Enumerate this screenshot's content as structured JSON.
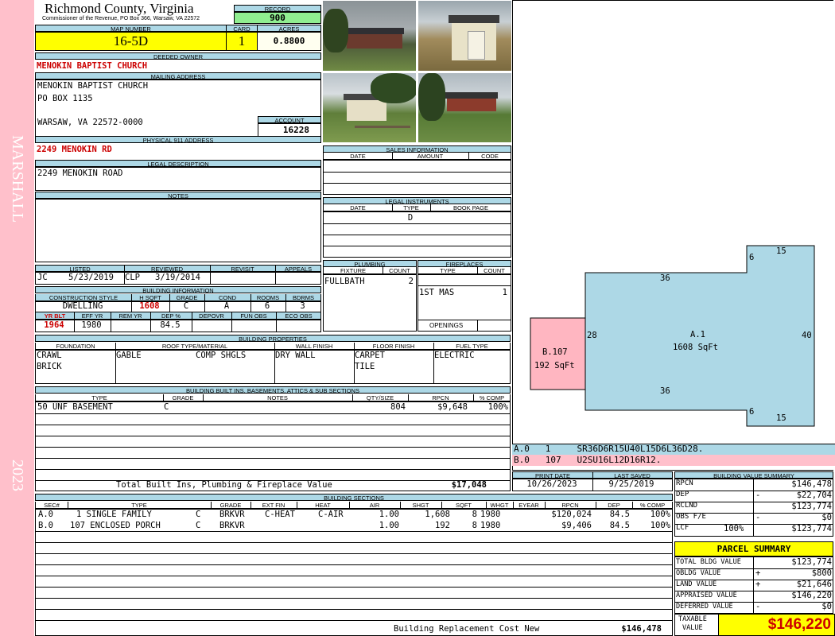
{
  "side": {
    "district": "MARSHALL",
    "year": "2023"
  },
  "header": {
    "county": "Richmond County, Virginia",
    "commissioner": "Commissioner of the Revenue, PO Box 366, Warsaw, VA 22572",
    "record_label": "RECORD",
    "record": "900",
    "map_label": "MAP NUMBER",
    "map_number": "16-5D",
    "card_label": "CARD",
    "card": "1",
    "acres_label": "ACRES",
    "acres": "0.8800"
  },
  "owner": {
    "deeded_label": "DEEDED OWNER",
    "deeded_owner": "MENOKIN BAPTIST CHURCH",
    "mailing_label": "MAILING ADDRESS",
    "mailing_line1": "MENOKIN BAPTIST CHURCH",
    "mailing_line2": "PO BOX 1135",
    "mailing_line3": "WARSAW, VA 22572-0000",
    "account_label": "ACCOUNT",
    "account": "16228",
    "physical_label": "PHYSICAL 911 ADDRESS",
    "physical_address": "2249 MENOKIN RD",
    "legal_label": "LEGAL DESCRIPTION",
    "legal_description": "2249 MENOKIN ROAD",
    "notes_label": "NOTES"
  },
  "listed": {
    "listed_label": "LISTED",
    "reviewed_label": "REVIEWED",
    "revisit_label": "REVISIT",
    "appeals_label": "APPEALS",
    "listed_by": "JC",
    "listed_date": "5/23/2019",
    "reviewed_by": "CLP",
    "reviewed_date": "3/19/2014"
  },
  "building_info": {
    "title": "BUILDING INFORMATION",
    "h_style": "CONSTRUCTION STYLE",
    "h_hsqft": "H SQFT",
    "h_grade": "GRADE",
    "h_cond": "COND",
    "h_rooms": "ROOMS",
    "h_bdrms": "BDRMS",
    "style": "DWELLING",
    "hsqft": "1608",
    "grade": "C",
    "cond": "A",
    "rooms": "6",
    "bdrms": "3",
    "h_yrblt": "YR BLT",
    "h_effyr": "EFF YR",
    "h_remyr": "REM YR",
    "h_dep": "DEP %",
    "h_depovr": "DEPOVR",
    "h_funobs": "FUN OBS",
    "h_ecoobs": "ECO OBS",
    "yrblt": "1964",
    "effyr": "1980",
    "dep": "84.5"
  },
  "sales": {
    "title": "SALES INFORMATION",
    "h_date": "DATE",
    "h_amount": "AMOUNT",
    "h_code": "CODE"
  },
  "legal_instruments": {
    "title": "LEGAL INSTRUMENTS",
    "h_date": "DATE",
    "h_type": "TYPE",
    "h_book": "BOOK PAGE",
    "type": "D"
  },
  "plumbing": {
    "title": "PLUMBING",
    "h_fixture": "FIXTURE",
    "h_count": "COUNT",
    "fixture": "FULLBATH",
    "count": "2"
  },
  "fireplaces": {
    "title": "FIREPLACES",
    "h_type": "TYPE",
    "h_count": "COUNT",
    "type": "1ST MAS",
    "count": "1",
    "openings_label": "OPENINGS"
  },
  "properties": {
    "title": "BUILDING PROPERTIES",
    "h_foundation": "FOUNDATION",
    "h_roof": "ROOF TYPE/MATERIAL",
    "h_wall": "WALL FINISH",
    "h_floor": "FLOOR FINISH",
    "h_fuel": "FUEL TYPE",
    "foundation1": "CRAWL",
    "foundation2": "BRICK",
    "roof_type": "GABLE",
    "roof_material": "COMP SHGLS",
    "wall": "DRY WALL",
    "floor1": "CARPET",
    "floor2": "TILE",
    "fuel": "ELECTRIC"
  },
  "built_ins": {
    "title": "BUILDING BUILT INS, BASEMENTS, ATTICS & SUB SECTIONS",
    "h_type": "TYPE",
    "h_grade": "GRADE",
    "h_notes": "NOTES",
    "h_qty": "QTY/SIZE",
    "h_rpcn": "RPCN",
    "h_comp": "% COMP",
    "rows": [
      {
        "type": "50 UNF BASEMENT",
        "grade": "C",
        "qty": "804",
        "rpcn": "$9,648",
        "comp": "100%"
      }
    ],
    "total_label": "Total Built Ins, Plumbing & Fireplace Value",
    "total": "$17,048"
  },
  "sketch": {
    "main_label": "A.1",
    "main_area": "1608 SqFt",
    "porch_label": "B.107",
    "porch_area": "192 SqFt",
    "dims": {
      "top36": "36",
      "bottom36": "36",
      "left28": "28",
      "right40": "40",
      "top15": "15",
      "top6": "6",
      "bottom6": "6",
      "bottom15": "15"
    },
    "code_a": "A.0   1     SR36D6R15U40L15D6L36D28.",
    "code_b": "B.0   107   U2SU16L12D16R12."
  },
  "dates": {
    "print_label": "PRINT DATE",
    "print_date": "10/26/2023",
    "saved_label": "LAST SAVED",
    "last_saved": "9/25/2019"
  },
  "sections": {
    "title": "BUILDING SECTIONS",
    "headers": [
      "SEC#",
      "TYPE",
      "GRADE",
      "EXT FIN",
      "HEAT",
      "AIR",
      "SHGT",
      "SQFT",
      "WHGT",
      "EYEAR",
      "RPCN",
      "DEP",
      "% COMP"
    ],
    "rows": [
      {
        "sec": "A.0",
        "type": "1 SINGLE FAMILY",
        "grade": "C",
        "ext": "BRKVR",
        "heat": "C-HEAT",
        "air": "C-AIR",
        "shgt": "1.00",
        "sqft": "1,608",
        "whgt": "8",
        "eyear": "1980",
        "rpcn": "$120,024",
        "dep": "84.5",
        "comp": "100%"
      },
      {
        "sec": "B.0",
        "type": "107 ENCLOSED PORCH",
        "grade": "C",
        "ext": "BRKVR",
        "heat": "",
        "air": "",
        "shgt": "1.00",
        "sqft": "192",
        "whgt": "8",
        "eyear": "1980",
        "rpcn": "$9,406",
        "dep": "84.5",
        "comp": "100%"
      }
    ],
    "replacement_label": "Building Replacement Cost New",
    "replacement": "$146,478"
  },
  "value_summary": {
    "title": "BUILDING VALUE SUMMARY",
    "rpcn_label": "RPCN",
    "rpcn": "$146,478",
    "dep_label": "DEP",
    "dep_sign": "-",
    "dep": "$22,704",
    "rclnd_label": "RCLND",
    "rclnd": "$123,774",
    "obs_label": "OBS F/E",
    "obs_sign": "-",
    "obs": "$0",
    "lcf_label": "LCF",
    "lcf_pct": "100%",
    "lcf": "$123,774"
  },
  "parcel_summary": {
    "title": "PARCEL SUMMARY",
    "bldg_label": "TOTAL BLDG VALUE",
    "bldg": "$123,774",
    "obldg_label": "OBLDG VALUE",
    "obldg_sign": "+",
    "obldg": "$800",
    "land_label": "LAND VALUE",
    "land_sign": "+",
    "land": "$21,646",
    "appraised_label": "APPRAISED VALUE",
    "appraised": "$146,220",
    "deferred_label": "DEFERRED VALUE",
    "deferred_sign": "-",
    "deferred": "$0",
    "taxable_label1": "TAXABLE",
    "taxable_label2": "VALUE",
    "taxable": "$146,220"
  },
  "colors": {
    "header_blue": "#add8e6",
    "side_pink": "#ffc0cb",
    "highlight_yellow": "#ffff00",
    "record_green": "#90ee90",
    "text_red": "#cc0000"
  }
}
